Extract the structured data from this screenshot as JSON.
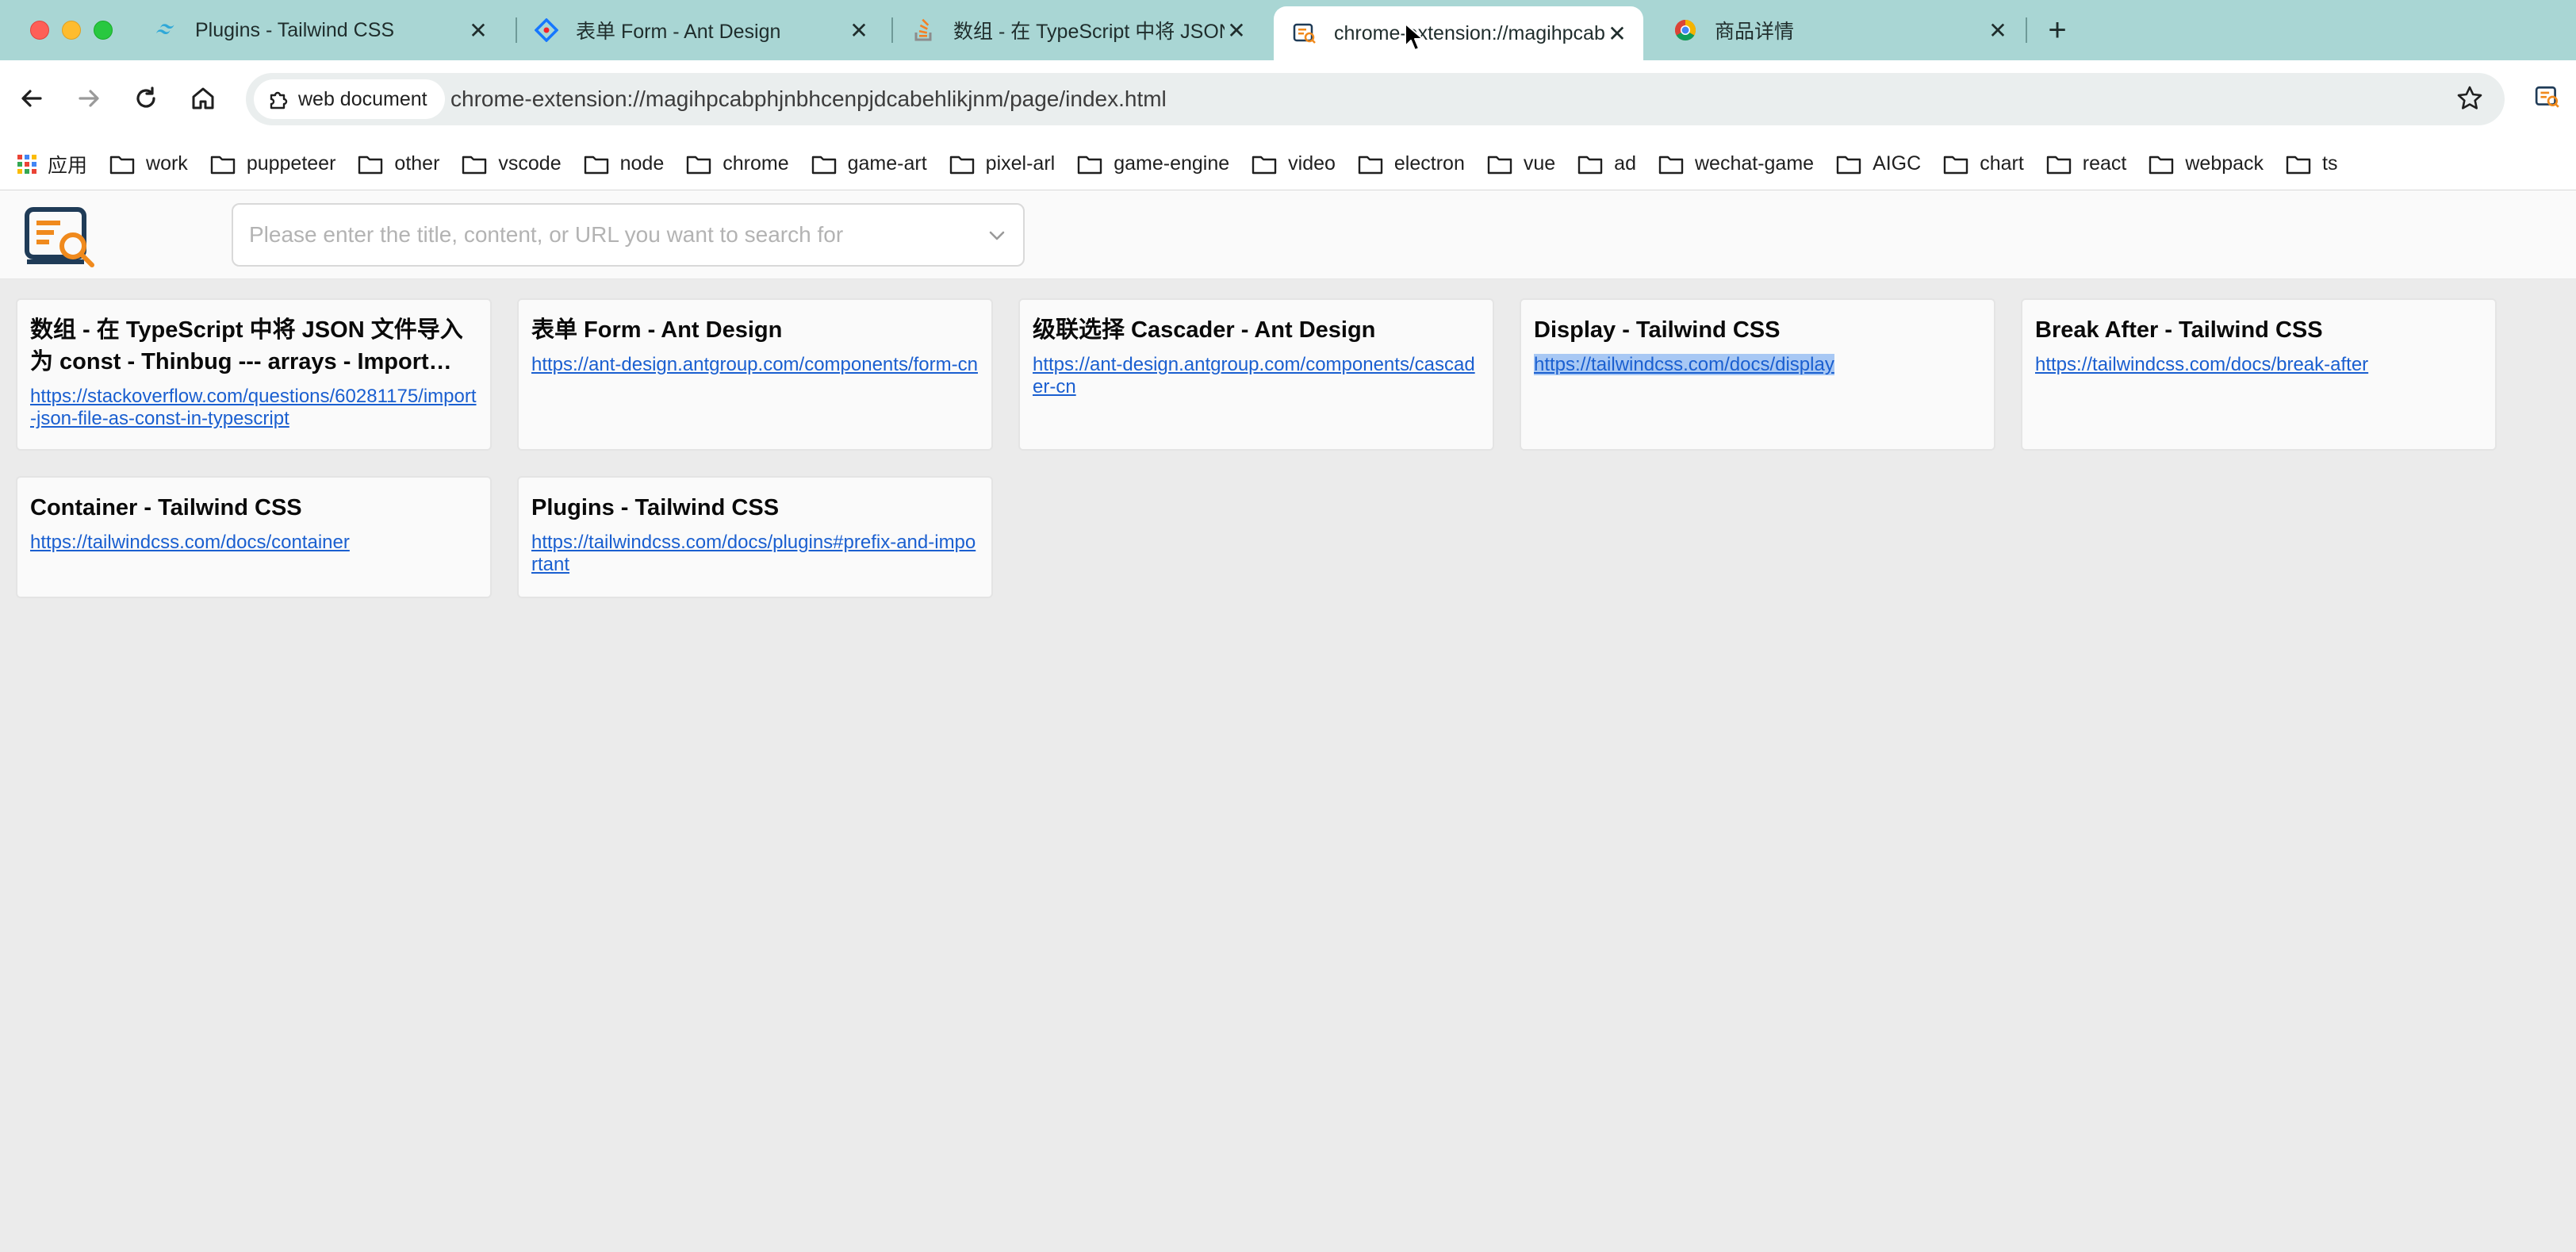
{
  "browser": {
    "tabs": [
      {
        "title": "Plugins - Tailwind CSS",
        "icon": "tailwind-icon",
        "active": false
      },
      {
        "title": "表单 Form - Ant Design",
        "icon": "antdesign-icon",
        "active": false
      },
      {
        "title": "数组 - 在 TypeScript 中将 JSON",
        "icon": "stackoverflow-icon",
        "active": false
      },
      {
        "title": "chrome-extension://magihpcabphjnbhcenpjdcabehlikjnm",
        "icon": "extension-page-icon",
        "active": true
      },
      {
        "title": "商品详情",
        "icon": "chrome-icon",
        "active": false
      }
    ],
    "close_glyph": "✕",
    "new_tab_glyph": "+",
    "site_chip_label": "web document",
    "url": "chrome-extension://magihpcabphjnbhcenpjdcabehlikjnm/page/index.html",
    "bookmarks": [
      {
        "label": "应用",
        "icon": "apps-grid-icon"
      },
      {
        "label": "work",
        "icon": "folder-icon"
      },
      {
        "label": "puppeteer",
        "icon": "folder-icon"
      },
      {
        "label": "other",
        "icon": "folder-icon"
      },
      {
        "label": "vscode",
        "icon": "folder-icon"
      },
      {
        "label": "node",
        "icon": "folder-icon"
      },
      {
        "label": "chrome",
        "icon": "folder-icon"
      },
      {
        "label": "game-art",
        "icon": "folder-icon"
      },
      {
        "label": "pixel-arl",
        "icon": "folder-icon"
      },
      {
        "label": "game-engine",
        "icon": "folder-icon"
      },
      {
        "label": "video",
        "icon": "folder-icon"
      },
      {
        "label": "electron",
        "icon": "folder-icon"
      },
      {
        "label": "vue",
        "icon": "folder-icon"
      },
      {
        "label": "ad",
        "icon": "folder-icon"
      },
      {
        "label": "wechat-game",
        "icon": "folder-icon"
      },
      {
        "label": "AIGC",
        "icon": "folder-icon"
      },
      {
        "label": "chart",
        "icon": "folder-icon"
      },
      {
        "label": "react",
        "icon": "folder-icon"
      },
      {
        "label": "webpack",
        "icon": "folder-icon"
      },
      {
        "label": "ts",
        "icon": "folder-icon"
      }
    ],
    "colors": {
      "tabstrip": "#a9d6d4",
      "link": "#1a5fd0",
      "selection": "#a8c8f4"
    }
  },
  "page": {
    "search": {
      "placeholder": "Please enter the title, content, or URL you want to search for",
      "value": ""
    },
    "cards": [
      {
        "title": "数组 - 在 TypeScript 中将 JSON 文件导入为 const - Thinbug --- arrays - Import JS...",
        "url": "https://stackoverflow.com/questions/60281175/import-json-file-as-const-in-typescript",
        "selected": false
      },
      {
        "title": "表单 Form - Ant Design",
        "url": "https://ant-design.antgroup.com/components/form-cn",
        "selected": false
      },
      {
        "title": "级联选择 Cascader - Ant Design",
        "url": "https://ant-design.antgroup.com/components/cascader-cn",
        "selected": false
      },
      {
        "title": "Display - Tailwind CSS",
        "url": "https://tailwindcss.com/docs/display",
        "selected": true
      },
      {
        "title": "Break After - Tailwind CSS",
        "url": "https://tailwindcss.com/docs/break-after",
        "selected": false
      },
      {
        "title": "Container - Tailwind CSS",
        "url": "https://tailwindcss.com/docs/container",
        "selected": false
      },
      {
        "title": "Plugins - Tailwind CSS",
        "url": "https://tailwindcss.com/docs/plugins#prefix-and-important",
        "selected": false
      }
    ]
  }
}
